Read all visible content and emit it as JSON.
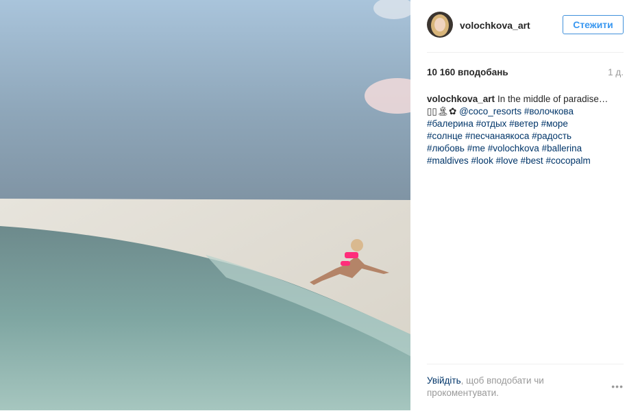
{
  "post": {
    "username": "volochkova_art",
    "follow_label": "Стежити",
    "likes": "10 160 вподобань",
    "age": "1 д.",
    "caption": {
      "username": "volochkova_art",
      "text": "In the middle of paradise…",
      "emoji": "▯▯🏝✿",
      "mention": "@coco_resorts",
      "hashtags": [
        "#волочкова",
        "#балерина",
        "#отдых",
        "#ветер",
        "#море",
        "#солнце",
        "#песчанаякоса",
        "#радость",
        "#любовь",
        "#me",
        "#volochkova",
        "#ballerina",
        "#maldives",
        "#look",
        "#love",
        "#best",
        "#cocopalm"
      ]
    }
  },
  "footer": {
    "login_link": "Увійдіть",
    "login_text": ", щоб вподобати чи прокоментувати.",
    "more_icon_label": "•••"
  },
  "colors": {
    "link": "#003569",
    "accent": "#3897f0",
    "muted": "#999999",
    "bikini": "#ff2d7a"
  }
}
